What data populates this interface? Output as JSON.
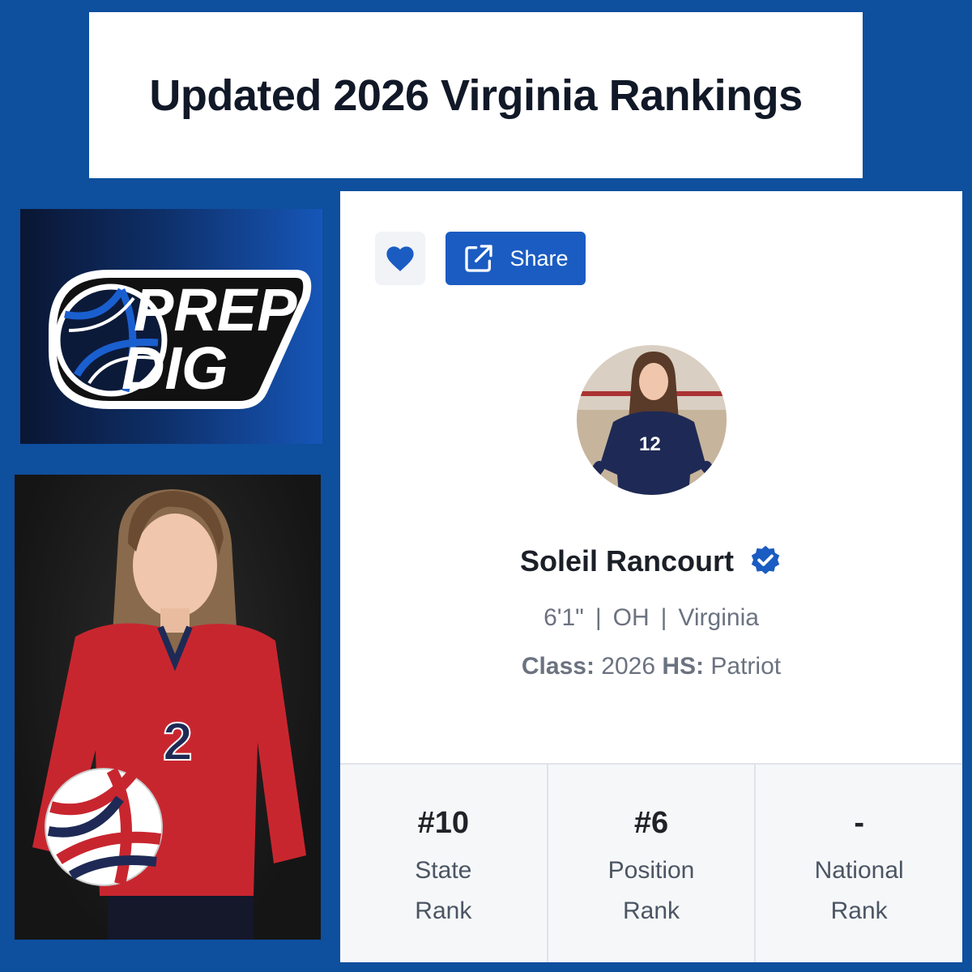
{
  "banner": {
    "title": "Updated 2026 Virginia Rankings"
  },
  "logo": {
    "line1": "PREP",
    "line2": "DIG"
  },
  "player_photo": {
    "jersey_number": "2"
  },
  "profile": {
    "favorite_icon": "heart-icon",
    "share_icon": "external-link-icon",
    "share_label": "Share",
    "avatar_jersey_number": "12",
    "name": "Soleil Rancourt",
    "verified_icon": "verified-badge-icon",
    "height": "6'1\"",
    "position": "OH",
    "state": "Virginia",
    "class_label": "Class:",
    "class_value": "2026",
    "hs_label": "HS:",
    "hs_value": "Patriot",
    "accent_color": "#1b5cc2"
  },
  "rankings": [
    {
      "value": "#10",
      "label": "State Rank"
    },
    {
      "value": "#6",
      "label": "Position Rank"
    },
    {
      "value": "-",
      "label": "National Rank"
    }
  ]
}
